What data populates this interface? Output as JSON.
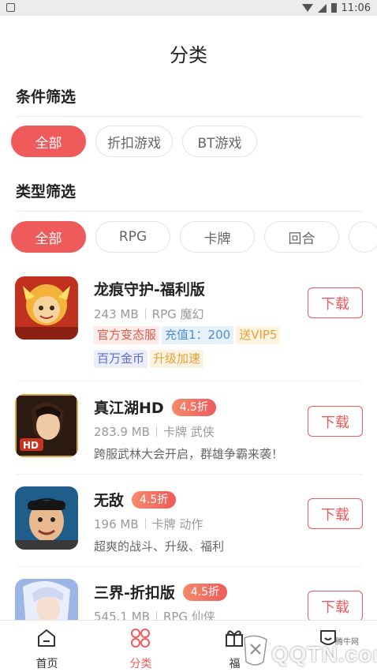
{
  "status_bar": {
    "time": "11:06"
  },
  "page": {
    "title": "分类"
  },
  "condition_filter": {
    "title": "条件筛选",
    "options": [
      "全部",
      "折扣游戏",
      "BT游戏"
    ],
    "selected": "全部"
  },
  "type_filter": {
    "title": "类型筛选",
    "options": [
      "全部",
      "RPG",
      "卡牌",
      "回合",
      ""
    ],
    "selected": "全部"
  },
  "games": [
    {
      "name": "龙痕守护-福利版",
      "size": "243 MB",
      "category": "RPG 魔幻",
      "tags_row1": [
        {
          "text": "官方变态服",
          "color": "red"
        },
        {
          "text": "充值1：200",
          "color": "blue"
        },
        {
          "text": "送VIP5",
          "color": "orange"
        }
      ],
      "tags_row2": [
        {
          "text": "百万金币",
          "color": "indigo"
        },
        {
          "text": "升级加速",
          "color": "orange"
        }
      ],
      "download_label": "下载"
    },
    {
      "name": "真江湖HD",
      "discount": "4.5折",
      "size": "283.9 MB",
      "category": "卡牌 武侠",
      "description": "跨服武林大会开启，群雄争霸来袭！",
      "download_label": "下载"
    },
    {
      "name": "无敌",
      "discount": "4.5折",
      "size": "196 MB",
      "category": "卡牌 动作",
      "description": "超爽的战斗、升级、福利",
      "download_label": "下载"
    },
    {
      "name": "三界-折扣版",
      "discount": "4.5折",
      "size": "545.1 MB",
      "category": "RPG 仙侠",
      "download_label": "下载"
    }
  ],
  "tab_bar": {
    "items": [
      {
        "label": "首页",
        "icon": "home-icon"
      },
      {
        "label": "分类",
        "icon": "category-icon",
        "active": true
      },
      {
        "label": "福",
        "icon": "gift-icon"
      },
      {
        "label": "",
        "icon": "profile-icon"
      }
    ]
  },
  "watermark": {
    "brand": "QQTN.com",
    "small_text": "腾牛网"
  },
  "colors": {
    "accent": "#ef5b5b"
  }
}
